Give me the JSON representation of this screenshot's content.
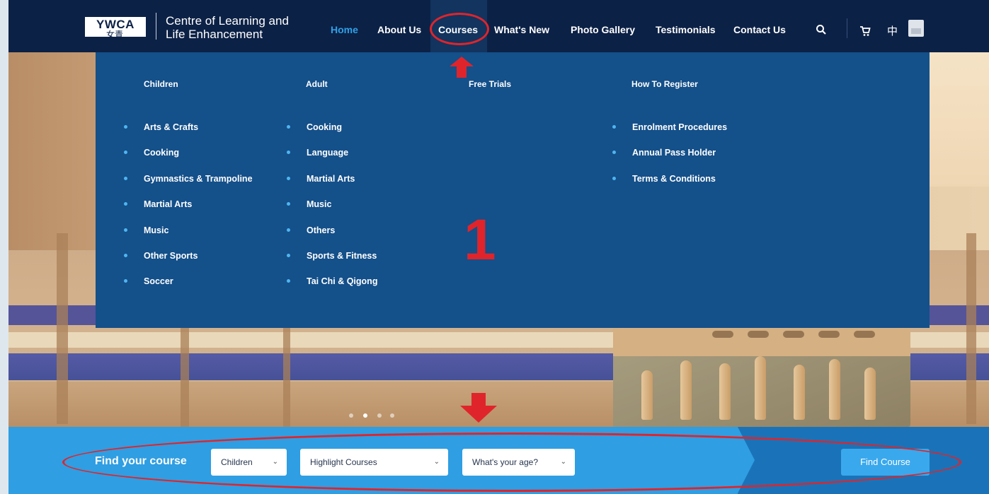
{
  "brand": {
    "logo_en": "YWCA",
    "logo_zh": "女青",
    "line1": "Centre of Learning and",
    "line2": "Life Enhancement"
  },
  "nav": {
    "items": [
      {
        "label": "Home",
        "active": true
      },
      {
        "label": "About Us"
      },
      {
        "label": "Courses",
        "open": true
      },
      {
        "label": "What's New"
      },
      {
        "label": "Photo Gallery"
      },
      {
        "label": "Testimonials"
      },
      {
        "label": "Contact Us"
      }
    ],
    "language_toggle": "中",
    "icons": [
      "search-icon",
      "cart-icon",
      "language-icon",
      "flag-icon"
    ]
  },
  "mega_menu": {
    "columns": [
      {
        "heading": "Children",
        "items": [
          "Arts & Crafts",
          "Cooking",
          "Gymnastics & Trampoline",
          "Martial Arts",
          "Music",
          "Other Sports",
          "Soccer"
        ]
      },
      {
        "heading": "Adult",
        "items": [
          "Cooking",
          "Language",
          "Martial Arts",
          "Music",
          "Others",
          "Sports & Fitness",
          "Tai Chi & Qigong"
        ]
      },
      {
        "heading": "Free Trials",
        "items": []
      },
      {
        "heading": "How To Register",
        "items": [
          "Enrolment Procedures",
          "Annual Pass Holder",
          "Terms & Conditions"
        ]
      }
    ]
  },
  "annotation": {
    "label": "1",
    "color": "#e0242b"
  },
  "carousel": {
    "dots": 4,
    "active_index": 1
  },
  "search": {
    "label": "Find your course",
    "category_select": "Children",
    "course_select": "Highlight Courses",
    "age_select": "What's your age?",
    "button": "Find Course"
  },
  "colors": {
    "nav_bg": "#0c2146",
    "menu_bg": "#14508a",
    "active_link": "#2fa1e8",
    "search_bar": "#2f9ee2",
    "annotation_red": "#e0242b"
  }
}
